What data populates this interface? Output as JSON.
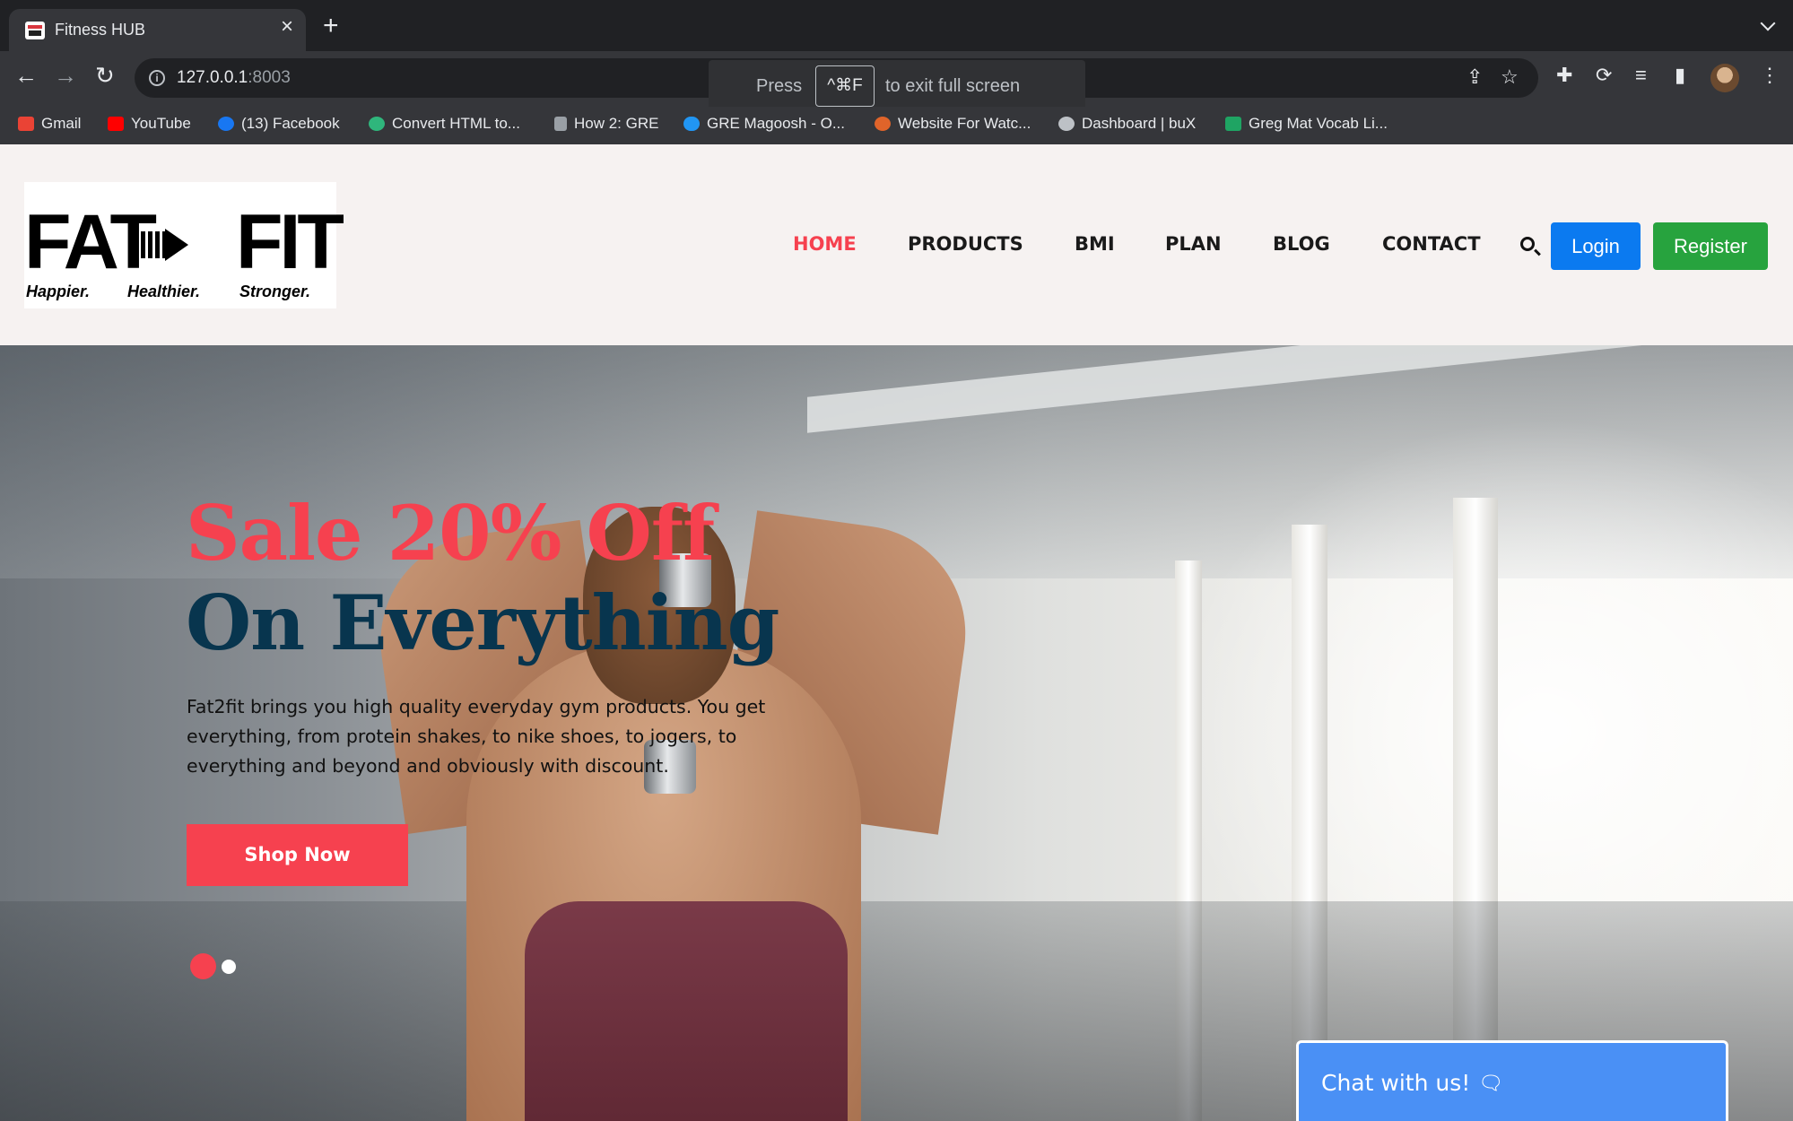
{
  "browser": {
    "tab_title": "Fitness HUB",
    "url_host": "127.0.0.1",
    "url_port": ":8003",
    "fullscreen_toast": {
      "prefix": "Press",
      "shortcut": "^⌘F",
      "suffix": "to exit full screen"
    },
    "bookmarks": [
      {
        "label": "Gmail",
        "icon": "gmail-icon",
        "color": "#ea4335"
      },
      {
        "label": "YouTube",
        "icon": "youtube-icon",
        "color": "#ff0000"
      },
      {
        "label": "(13) Facebook",
        "icon": "facebook-icon",
        "color": "#1877f2"
      },
      {
        "label": "Convert HTML to...",
        "icon": "convert-icon",
        "color": "#2fb67c"
      },
      {
        "label": "How 2: GRE",
        "icon": "doc-icon",
        "color": "#9aa0a6"
      },
      {
        "label": "GRE Magoosh - O...",
        "icon": "cloud-icon",
        "color": "#2196f3"
      },
      {
        "label": "Website For Watc...",
        "icon": "watch-icon",
        "color": "#e0642a"
      },
      {
        "label": "Dashboard | buX",
        "icon": "dashboard-icon",
        "color": "#bdc1c6"
      },
      {
        "label": "Greg Mat Vocab Li...",
        "icon": "sheets-icon",
        "color": "#1fa463"
      }
    ]
  },
  "header": {
    "logo": {
      "word1": "FAT",
      "word2": "FIT",
      "connector": "to",
      "tagline": [
        "Happier.",
        "Healthier.",
        "Stronger."
      ]
    },
    "nav": [
      "HOME",
      "PRODUCTS",
      "BMI",
      "PLAN",
      "BLOG",
      "CONTACT"
    ],
    "active_nav": "HOME",
    "login_label": "Login",
    "register_label": "Register"
  },
  "hero": {
    "title_line1": "Sale 20% Off",
    "title_line2": "On Everything",
    "description": "Fat2fit brings you high quality everyday gym products. You get everything, from protein shakes, to nike shoes, to jogers, to everything and beyond and obviously with discount.",
    "cta_label": "Shop Now",
    "slides": 2,
    "active_slide": 1
  },
  "chat": {
    "label": "Chat with us!"
  },
  "colors": {
    "accent": "#f6414f",
    "navy": "#08354e",
    "login": "#0b7af0",
    "register": "#27a33e",
    "chat": "#4a90f5"
  }
}
